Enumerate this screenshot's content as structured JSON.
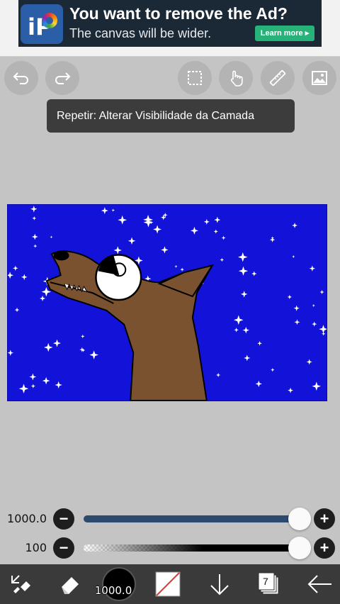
{
  "ad": {
    "title": "You want to remove the Ad?",
    "subtitle": "The canvas will be wider.",
    "cta": "Learn more ▸",
    "logo_text": "iP"
  },
  "toolbar_top": {
    "icons": [
      "undo-icon",
      "redo-icon",
      "selection-icon",
      "hand-icon",
      "ruler-icon",
      "image-icon"
    ]
  },
  "toast": {
    "text": "Repetir: Alterar Visibilidade da Camada"
  },
  "sliders": {
    "size": {
      "label": "1000.0",
      "value_fraction": 1.0
    },
    "opacity": {
      "label": "100",
      "value_fraction": 1.0
    },
    "minus": "−",
    "plus": "+"
  },
  "bottom_toolbar": {
    "brush_size": "1000.0",
    "layer_count": "7",
    "icons": [
      "transform-icon",
      "eraser-icon",
      "brush-color-icon",
      "secondary-color-icon",
      "move-down-icon",
      "layers-icon",
      "back-arrow-icon"
    ]
  },
  "colors": {
    "canvas_bg": "#1212d8",
    "slider_track_size": "#2b4a6e",
    "toolbar_bg": "#3a3a3a",
    "app_bg": "#c4c4c4"
  }
}
